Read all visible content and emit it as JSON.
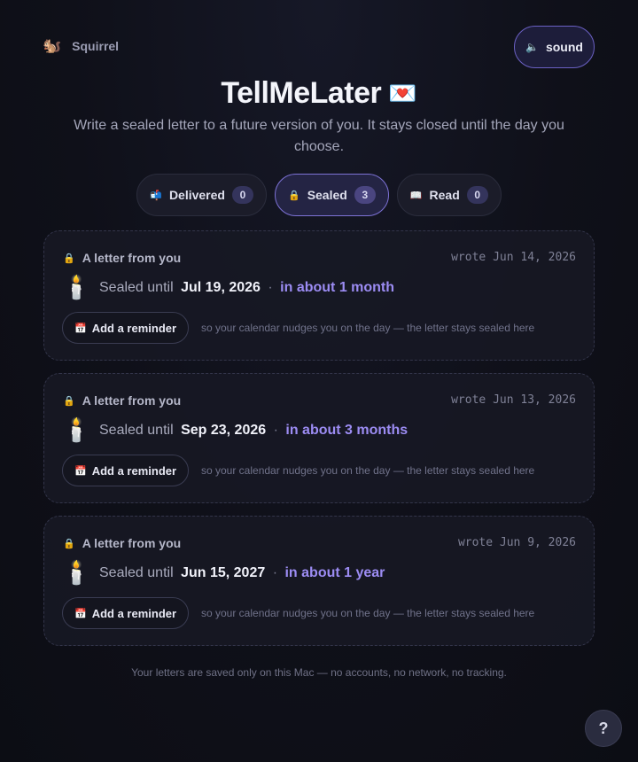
{
  "header": {
    "brand_icon": "🐿️",
    "brand_name": "Squirrel",
    "sound_icon": "🔈",
    "sound_label": "sound"
  },
  "app": {
    "title": "TellMeLater",
    "title_emoji": "💌",
    "subtitle": "Write a sealed letter to a future version of you. It stays closed until the day you choose."
  },
  "tabs": [
    {
      "icon": "📬",
      "label": "Delivered",
      "count": "0",
      "active": false
    },
    {
      "icon": "🔒",
      "label": "Sealed",
      "count": "3",
      "active": true
    },
    {
      "icon": "📖",
      "label": "Read",
      "count": "0",
      "active": false
    }
  ],
  "letters": [
    {
      "lock_icon": "🔒",
      "from": "A letter from you",
      "wrote": "wrote Jun 14, 2026",
      "candle_icon": "🕯️",
      "sealed_label": "Sealed until",
      "sealed_date": "Jul 19, 2026",
      "separator": "·",
      "relative": "in about 1 month",
      "reminder_icon": "📅",
      "reminder_label": "Add a reminder",
      "reminder_hint": "so your calendar nudges you on the day — the letter stays sealed here"
    },
    {
      "lock_icon": "🔒",
      "from": "A letter from you",
      "wrote": "wrote Jun 13, 2026",
      "candle_icon": "🕯️",
      "sealed_label": "Sealed until",
      "sealed_date": "Sep 23, 2026",
      "separator": "·",
      "relative": "in about 3 months",
      "reminder_icon": "📅",
      "reminder_label": "Add a reminder",
      "reminder_hint": "so your calendar nudges you on the day — the letter stays sealed here"
    },
    {
      "lock_icon": "🔒",
      "from": "A letter from you",
      "wrote": "wrote Jun 9, 2026",
      "candle_icon": "🕯️",
      "sealed_label": "Sealed until",
      "sealed_date": "Jun 15, 2027",
      "separator": "·",
      "relative": "in about 1 year",
      "reminder_icon": "📅",
      "reminder_label": "Add a reminder",
      "reminder_hint": "so your calendar nudges you on the day — the letter stays sealed here"
    }
  ],
  "footer": {
    "text": "Your letters are saved only on this Mac — no accounts, no network, no tracking."
  },
  "help": {
    "label": "?"
  },
  "colors": {
    "accent": "#9c8cf3",
    "active_border": "#7d72d6",
    "background": "#0e0f17"
  }
}
